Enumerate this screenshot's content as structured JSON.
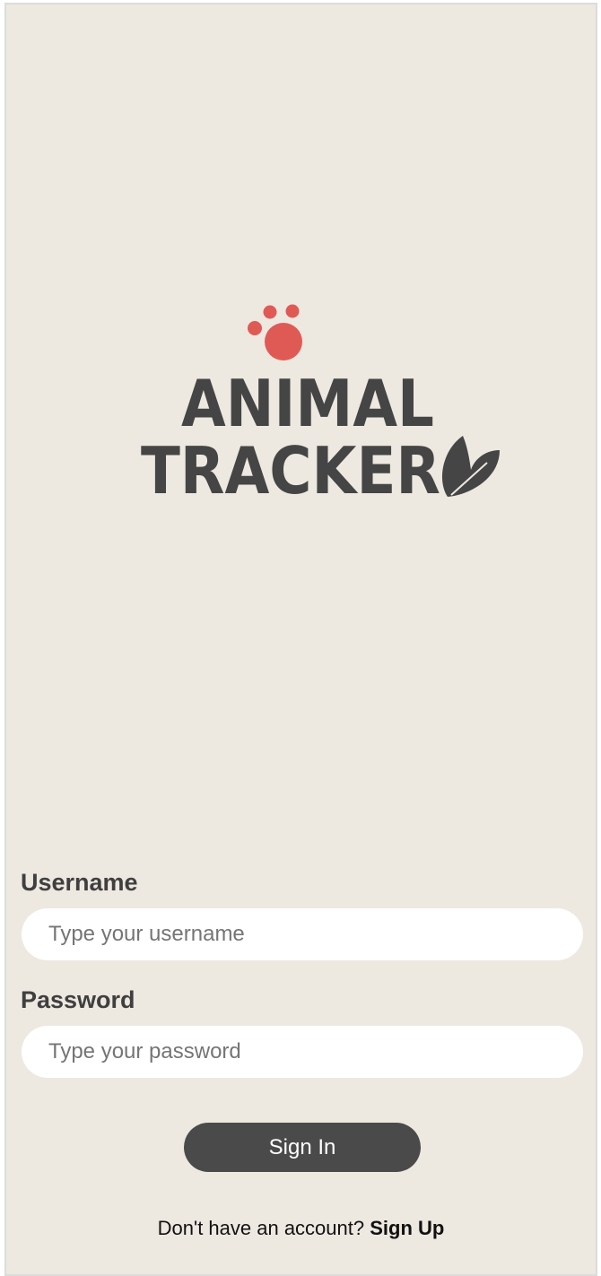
{
  "logo": {
    "line1": "ANIMAL",
    "line2": "TRACKER",
    "paw_color": "#e05a55",
    "text_color": "#454545",
    "icons": [
      "paw-icon",
      "leaf-icon"
    ]
  },
  "form": {
    "username_label": "Username",
    "username_placeholder": "Type your username",
    "password_label": "Password",
    "password_placeholder": "Type your password",
    "submit_label": "Sign In"
  },
  "footer": {
    "prompt": "Don't have an account?",
    "link": "Sign Up"
  },
  "colors": {
    "background": "#ede8e0",
    "button": "#4a4a4a",
    "input_bg": "#ffffff"
  }
}
